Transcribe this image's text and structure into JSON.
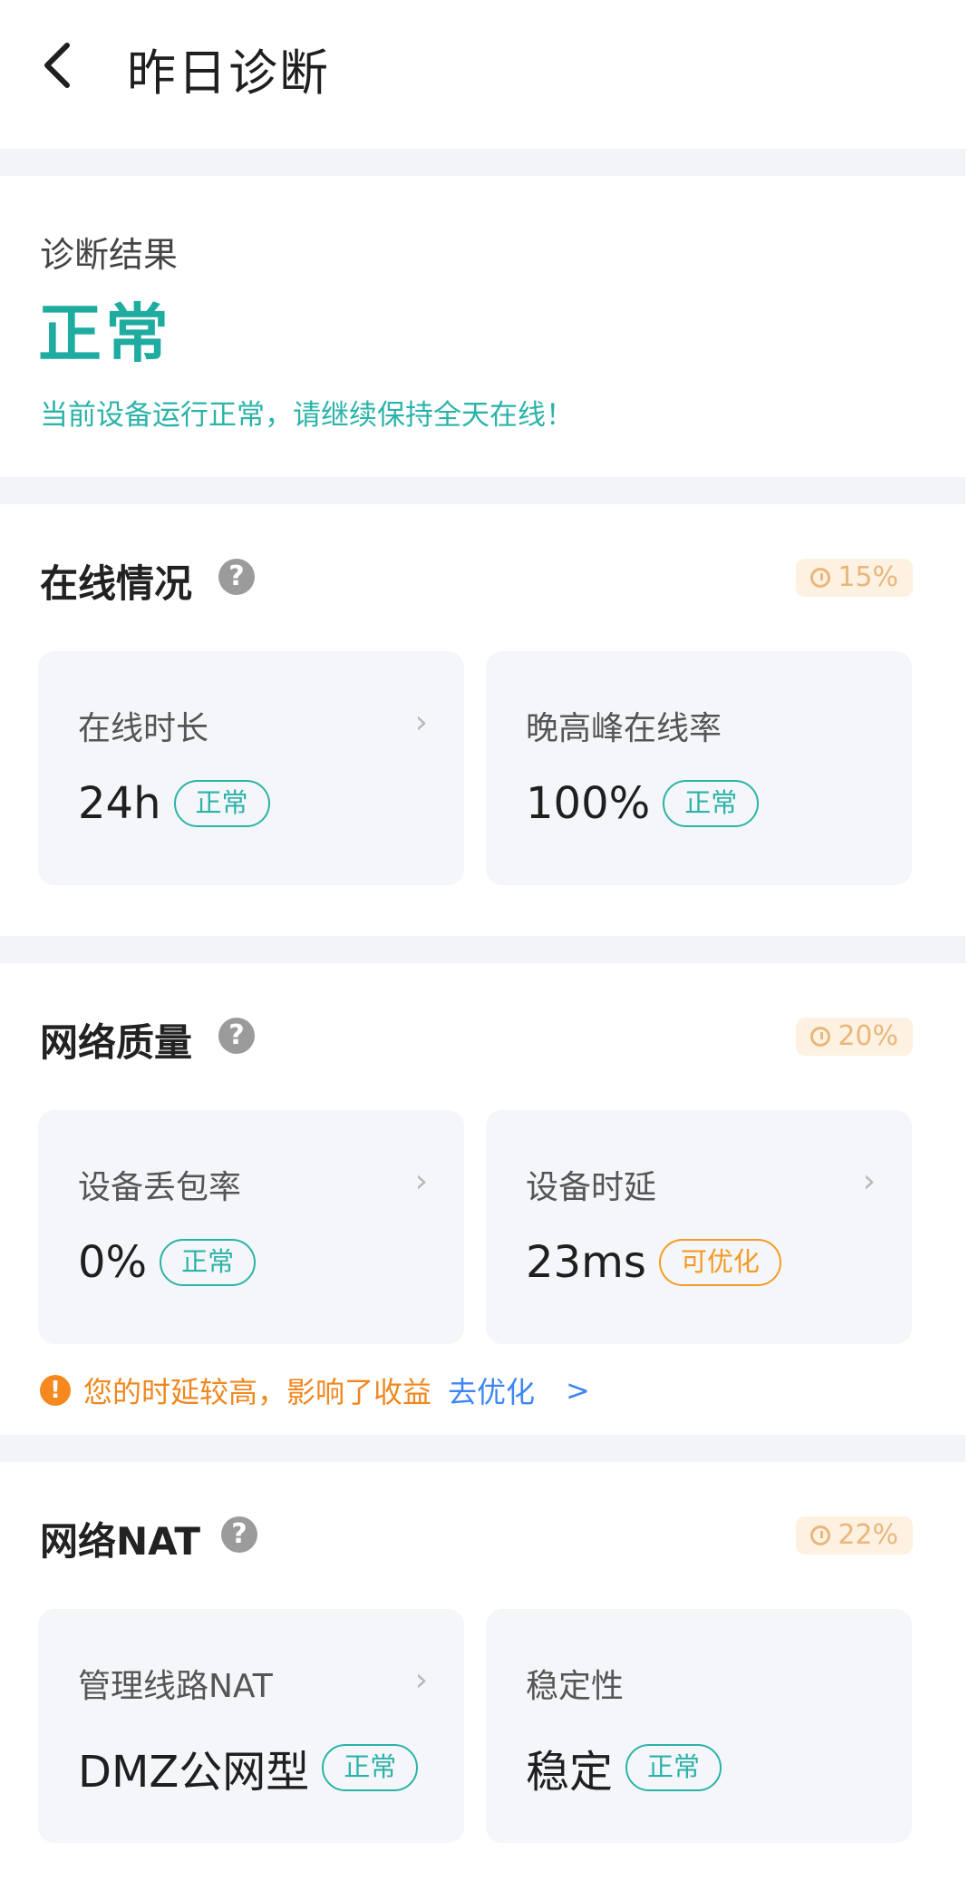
{
  "header": {
    "title": "昨日诊断"
  },
  "result": {
    "label": "诊断结果",
    "status": "正常",
    "description": "当前设备运行正常，请继续保持全天在线！"
  },
  "sections": [
    {
      "title": "在线情况",
      "weight": "15%",
      "cards": [
        {
          "label": "在线时长",
          "value": "24h",
          "tag": "正常",
          "has_arrow": true
        },
        {
          "label": "晚高峰在线率",
          "value": "100%",
          "tag": "正常",
          "has_arrow": false
        }
      ]
    },
    {
      "title": "网络质量",
      "weight": "20%",
      "cards": [
        {
          "label": "设备丢包率",
          "value": "0%",
          "tag": "正常",
          "has_arrow": true
        },
        {
          "label": "设备时延",
          "value": "23ms",
          "tag": "可优化",
          "has_arrow": true
        }
      ],
      "tip": {
        "text": "您的时延较高，影响了收益",
        "link": "去优化",
        "arrow": ">"
      }
    },
    {
      "title": "网络NAT",
      "weight": "22%",
      "cards": [
        {
          "label": "管理线路NAT",
          "value": "DMZ公网型",
          "tag": "正常",
          "has_arrow": true
        },
        {
          "label": "稳定性",
          "value": "稳定",
          "tag": "正常",
          "has_arrow": false
        }
      ]
    }
  ],
  "colors": {
    "accent": "#1eaca1",
    "warning": "#f59a23",
    "link": "#3d86f5",
    "badge_bg": "#fdf1e2",
    "card_bg": "#f5f6f9"
  },
  "icons": {
    "back": "chevron-left-icon",
    "help": "question-circle-icon",
    "weight": "clock-icon",
    "card_arrow": "chevron-right-icon",
    "tip": "exclamation-circle-icon"
  }
}
